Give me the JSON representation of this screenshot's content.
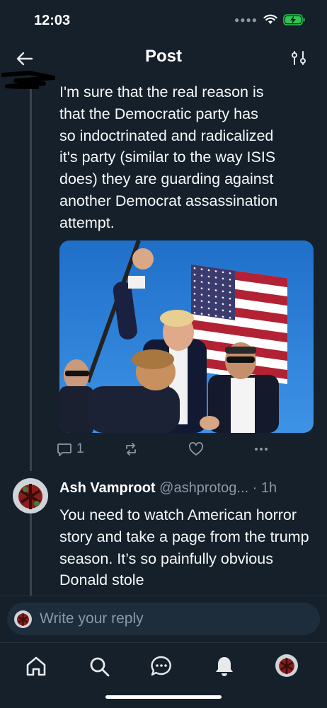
{
  "status_bar": {
    "time": "12:03"
  },
  "header": {
    "title": "Post"
  },
  "post": {
    "text": "I'm sure that the real reason is\nthat the Democratic party has\nso indoctrinated and radicalized\nit's party (similar to the way ISIS\ndoes) they are guarding against\nanother Democrat assassination\nattempt.",
    "reply_count": "1"
  },
  "reply": {
    "name": "Ash Vamproot",
    "handle": "@ashprotog...",
    "separator": "·",
    "time": "1h",
    "text": "You need to watch American horror story and take a page from the trump season. It’s so painfully obvious Donald stole"
  },
  "composer": {
    "placeholder": "Write your reply"
  },
  "colors": {
    "background": "#15202b",
    "secondary_text": "#8b98a5",
    "battery": "#2ec84e"
  },
  "icons": {
    "back": "arrow-left-icon",
    "filter": "sliders-icon",
    "reply": "comment-icon",
    "repost": "repost-icon",
    "like": "heart-icon",
    "more": "more-icon",
    "home": "home-icon",
    "search": "search-icon",
    "messages": "chat-icon",
    "notifications": "bell-icon"
  }
}
